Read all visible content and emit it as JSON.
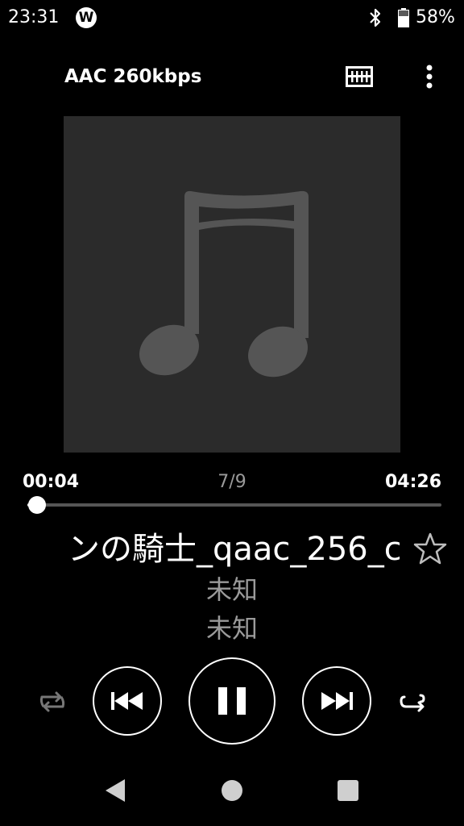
{
  "status_bar": {
    "time": "23:31",
    "app_icon": "walkman-icon",
    "app_icon_glyph": "W",
    "bluetooth_icon": "bluetooth-icon",
    "battery_icon": "battery-icon",
    "battery_percent": "58%"
  },
  "header": {
    "codec": "AAC 260kbps",
    "equalizer_icon": "equalizer-icon",
    "more_icon": "more-vert-icon"
  },
  "artwork": {
    "placeholder_icon": "music-note-icon",
    "background_color": "#2b2b2b",
    "icon_color": "#555555"
  },
  "progress": {
    "elapsed": "00:04",
    "track_position": "7/9",
    "total": "04:26",
    "fraction": 0.015
  },
  "track": {
    "title": "ンの騎士_qaac_256_c",
    "artist": "未知",
    "album": "未知",
    "favorite_icon": "star-outline-icon"
  },
  "controls": {
    "shuffle_icon": "shuffle-icon",
    "previous_icon": "skip-previous-icon",
    "pause_icon": "pause-icon",
    "next_icon": "skip-next-icon",
    "repeat_icon": "repeat-icon"
  },
  "nav_bar": {
    "back_icon": "back-triangle-icon",
    "home_icon": "home-circle-icon",
    "recents_icon": "recents-square-icon"
  }
}
